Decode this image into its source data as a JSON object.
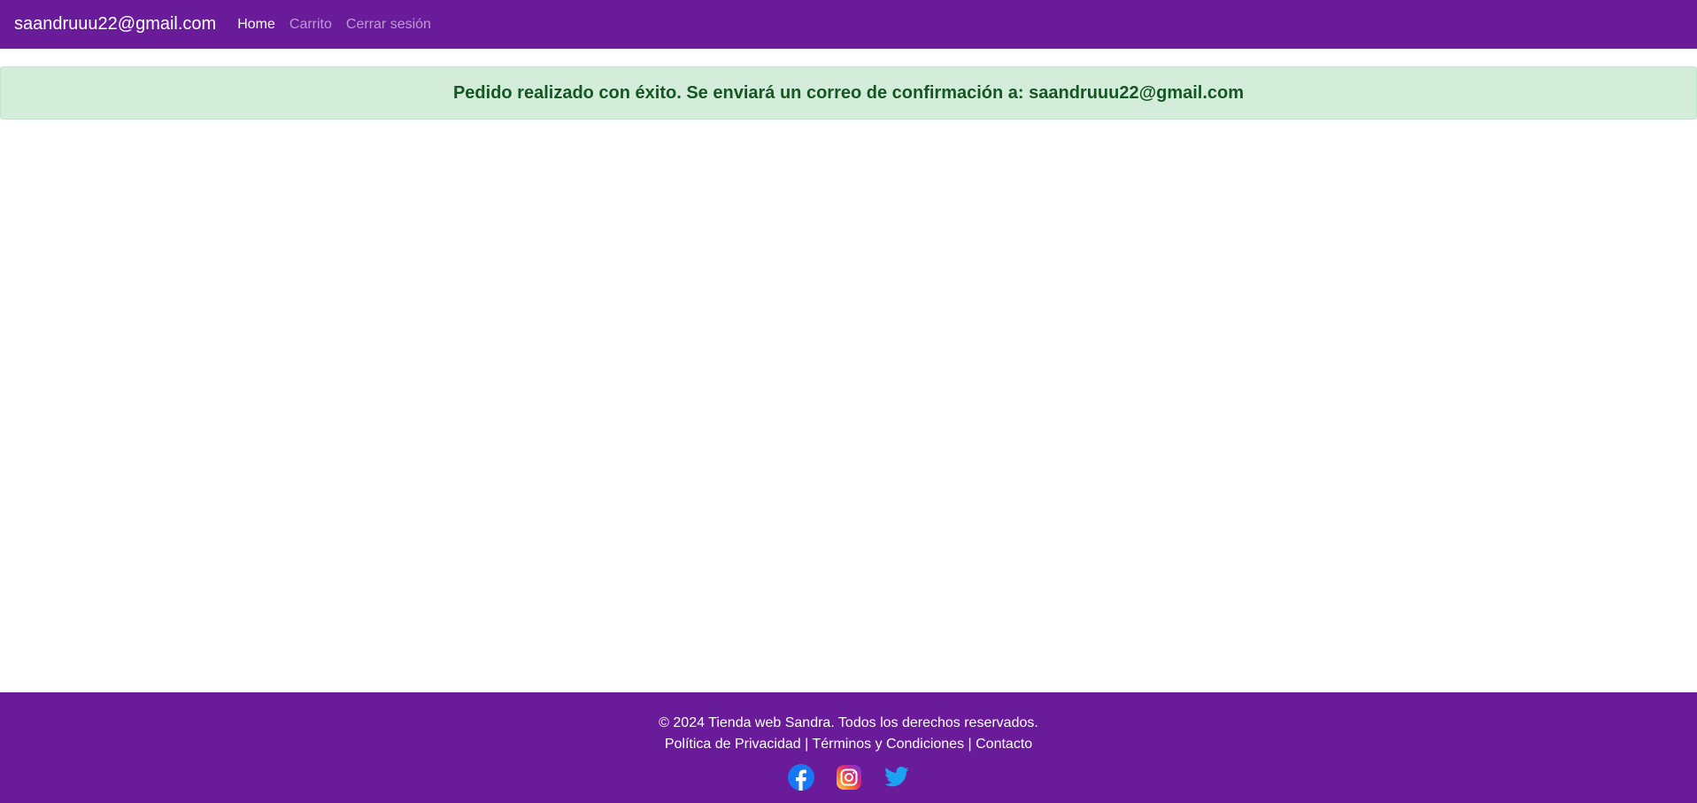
{
  "navbar": {
    "brand": "saandruuu22@gmail.com",
    "links": [
      {
        "label": "Home"
      },
      {
        "label": "Carrito"
      },
      {
        "label": "Cerrar sesión"
      }
    ]
  },
  "alert": {
    "message": "Pedido realizado con éxito. Se enviará un correo de confirmación a: saandruuu22@gmail.com"
  },
  "footer": {
    "copyright": "© 2024 Tienda web Sandra. Todos los derechos reservados.",
    "links": [
      {
        "label": "Política de Privacidad"
      },
      {
        "label": "Términos y Condiciones"
      },
      {
        "label": "Contacto"
      }
    ],
    "separator": "|",
    "social_icons": [
      "facebook-icon",
      "instagram-icon",
      "twitter-icon"
    ]
  },
  "colors": {
    "brand_purple": "#6a1b9a",
    "alert_bg": "#d4edda",
    "alert_text": "#155724"
  }
}
